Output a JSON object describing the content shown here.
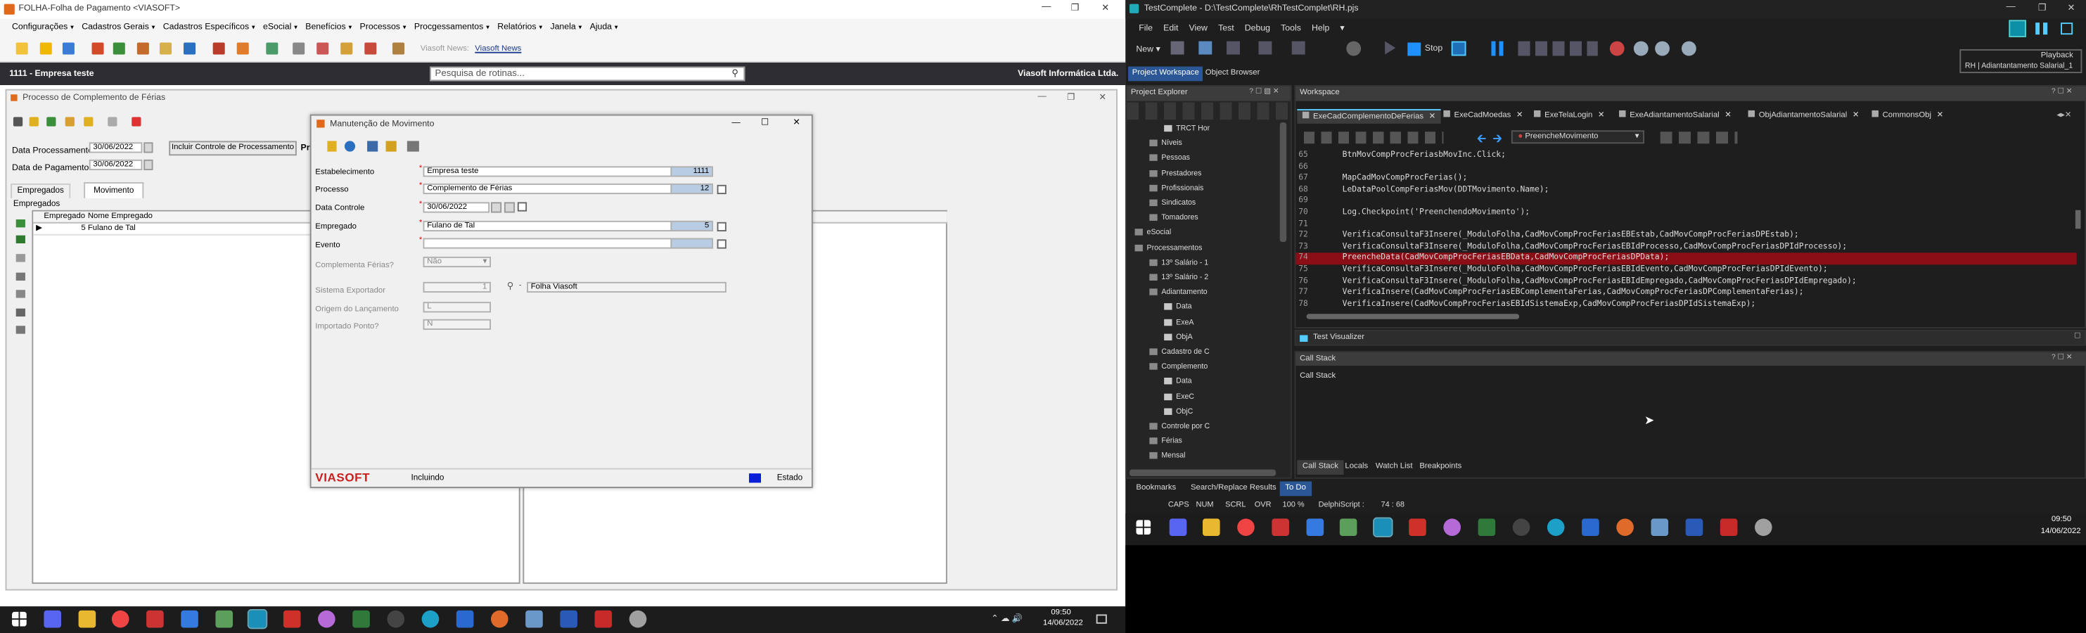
{
  "left_window": {
    "title": "FOLHA-Folha de Pagamento <VIASOFT>",
    "menu": [
      "Configurações",
      "Cadastros Gerais",
      "Cadastros Específicos",
      "eSocial",
      "Benefícios",
      "Processos",
      "Procgessamentos",
      "Relatórios",
      "Janela",
      "Ajuda"
    ],
    "news_label": "Viasoft News:",
    "news_link": "Viasoft News",
    "company": "1111 - Empresa teste",
    "vendor": "Viasoft Informática Ltda.",
    "search_placeholder": "Pesquisa de rotinas..."
  },
  "process_window": {
    "title": "Processo de Complemento de Férias",
    "data_processamento_label": "Data Processamento",
    "data_processamento_value": "30/06/2022",
    "data_pagamento_label": "Data de Pagamento",
    "data_pagamento_value": "30/06/2022",
    "include_button": "Incluir Controle de Processamento",
    "cut_label": "Pr",
    "tabs": [
      "Empregados",
      "Movimento"
    ],
    "group_label": "Empregados",
    "grid_headers": [
      "Empregado",
      "Nome Empregado"
    ],
    "grid_rows": [
      {
        "empregado": "5",
        "nome": "Fulano de Tal"
      }
    ]
  },
  "movement_dialog": {
    "title": "Manutenção de Movimento",
    "estabelecimento_label": "Estabelecimento",
    "estabelecimento_value": "Empresa teste",
    "estabelecimento_code": "1111",
    "processo_label": "Processo",
    "processo_value": "Complemento de Férias",
    "processo_code": "12",
    "data_controle_label": "Data Controle",
    "data_controle_value": "30/06/2022",
    "empregado_label": "Empregado",
    "empregado_value": "Fulano de Tal",
    "empregado_code": "5",
    "evento_label": "Evento",
    "complemento_label": "Complementa Férias?",
    "complemento_value": "Não",
    "sistema_label": "Sistema Exportador",
    "sistema_code": "1",
    "sistema_value": "Folha Viasoft",
    "origem_label": "Origem do Lançamento",
    "origem_value": "L",
    "importado_label": "Importado Ponto?",
    "importado_value": "N",
    "footer_logo": "VIASOFT",
    "footer_status": "Incluindo",
    "footer_estado": "Estado"
  },
  "taskbar_left": {
    "time": "09:50",
    "date": "14/06/2022"
  },
  "right_window": {
    "title": "TestComplete - D:\\TestComplete\\RhTestComplet\\RH.pjs",
    "menu": [
      "File",
      "Edit",
      "View",
      "Test",
      "Debug",
      "Tools",
      "Help"
    ],
    "new_label": "New",
    "stop_label": "Stop",
    "playback_label": "Playback",
    "playback_sub": "RH | Adiantantamento Salarial_1",
    "panel_tabs": [
      "Project Workspace",
      "Object Browser"
    ],
    "project_explorer": "Project Explorer",
    "workspace": "Workspace",
    "doc_tabs": [
      "ExeCadComplementoDeFerias",
      "ExeCadMoedas",
      "ExeTelaLogin",
      "ExeAdiantamentoSalarial",
      "ObjAdiantamentoSalarial",
      "CommonsObj"
    ],
    "routine_select": "PreencheMovimento",
    "tree": [
      {
        "label": "TRCT Hor",
        "level": 3
      },
      {
        "label": "Níveis",
        "level": 2
      },
      {
        "label": "Pessoas",
        "level": 2
      },
      {
        "label": "Prestadores",
        "level": 2
      },
      {
        "label": "Profissionais",
        "level": 2
      },
      {
        "label": "Sindicatos",
        "level": 2
      },
      {
        "label": "Tomadores",
        "level": 2
      },
      {
        "label": "eSocial",
        "level": 1
      },
      {
        "label": "Processamentos",
        "level": 1
      },
      {
        "label": "13º Salário - 1",
        "level": 2
      },
      {
        "label": "13º Salário - 2",
        "level": 2
      },
      {
        "label": "Adiantamento",
        "level": 2
      },
      {
        "label": "Data",
        "level": 3
      },
      {
        "label": "ExeA",
        "level": 3
      },
      {
        "label": "ObjA",
        "level": 3
      },
      {
        "label": "Cadastro de C",
        "level": 2
      },
      {
        "label": "Complemento",
        "level": 2
      },
      {
        "label": "Data",
        "level": 3
      },
      {
        "label": "ExeC",
        "level": 3
      },
      {
        "label": "ObjC",
        "level": 3
      },
      {
        "label": "Controle por C",
        "level": 2
      },
      {
        "label": "Férias",
        "level": 2
      },
      {
        "label": "Mensal",
        "level": 2
      }
    ],
    "code_lines": [
      {
        "n": "65",
        "t": "BtnMovCompProcFeriasbMovInc.Click;"
      },
      {
        "n": "66",
        "t": ""
      },
      {
        "n": "67",
        "t": "MapCadMovCompProcFerias();"
      },
      {
        "n": "68",
        "t": "LeDataPoolCompFeriasMov(DDTMovimento.Name);"
      },
      {
        "n": "69",
        "t": ""
      },
      {
        "n": "70",
        "t": "Log.Checkpoint('PreenchendoMovimento');"
      },
      {
        "n": "71",
        "t": ""
      },
      {
        "n": "72",
        "t": "VerificaConsultaF3Insere(_ModuloFolha,CadMovCompProcFeriasEBEstab,CadMovCompProcFeriasDPEstab);"
      },
      {
        "n": "73",
        "t": "VerificaConsultaF3Insere(_ModuloFolha,CadMovCompProcFeriasEBIdProcesso,CadMovCompProcFeriasDPIdProcesso);"
      },
      {
        "n": "74",
        "t": "PreencheData(CadMovCompProcFeriasEBData,CadMovCompProcFeriasDPData);"
      },
      {
        "n": "75",
        "t": "VerificaConsultaF3Insere(_ModuloFolha,CadMovCompProcFeriasEBIdEvento,CadMovCompProcFeriasDPIdEvento);"
      },
      {
        "n": "76",
        "t": "VerificaConsultaF3Insere(_ModuloFolha,CadMovCompProcFeriasEBIdEmpregado,CadMovCompProcFeriasDPIdEmpregado);"
      },
      {
        "n": "77",
        "t": "VerificaInsere(CadMovCompProcFeriasEBComplementaFerias,CadMovCompProcFeriasDPComplementaFerias);"
      },
      {
        "n": "78",
        "t": "VerificaInsere(CadMovCompProcFeriasEBIdSistemaExp,CadMovCompProcFeriasDPIdSistemaExp);"
      }
    ],
    "test_visualizer": "Test Visualizer",
    "call_stack_title": "Call Stack",
    "call_stack_header": "Call Stack",
    "bottom_tabs": [
      "Call Stack",
      "Locals",
      "Watch List",
      "Breakpoints"
    ],
    "lower_tabs": [
      "Bookmarks",
      "Search/Replace Results",
      "To Do"
    ],
    "status": [
      "CAPS",
      "NUM",
      "SCRL",
      "OVR",
      "100 %",
      "DelphiScript :",
      "74 : 68"
    ],
    "time": "09:50",
    "date": "14/06/2022"
  },
  "colors": {
    "code_highlight": "#8b0d16",
    "accent": "#1e90ff"
  }
}
